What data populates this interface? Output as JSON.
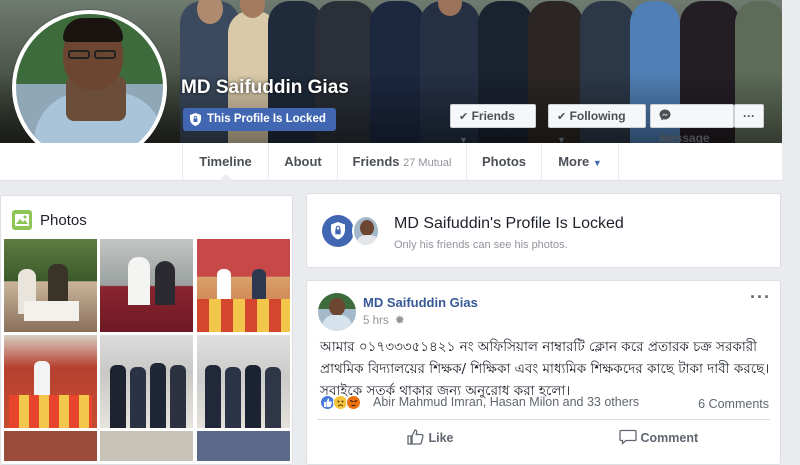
{
  "profile": {
    "name": "MD Saifuddin Gias",
    "locked_badge": "This Profile Is Locked"
  },
  "cover_buttons": {
    "friends": "Friends",
    "following": "Following",
    "message": "Message",
    "more": "···"
  },
  "nav": {
    "timeline": "Timeline",
    "about": "About",
    "friends": "Friends",
    "friends_mutual": "27 Mutual",
    "photos": "Photos",
    "more": "More"
  },
  "photos_panel": {
    "title": "Photos"
  },
  "locked_notice": {
    "title": "MD Saifuddin's Profile Is Locked",
    "subtitle": "Only his friends can see his photos."
  },
  "post": {
    "author": "MD Saifuddin Gias",
    "time": "5 hrs",
    "options": "···",
    "text": "আমার ০১৭৩৩৩৫১৪২১ নং অফিসিয়াল নাম্বারটি ক্লোন করে প্রতারক চক্র সরকারী প্রাথমিক বিদ্যালয়ের শিক্ষক/ শিক্ষিকা এবং মাধ্যমিক শিক্ষকদের কাছে টাকা দাবী করছে। সবাইকে সতর্ক থাকার জন্য অনুরোধ করা হলো।",
    "reactions_text": "Abir Mahmud Imran, Hasan Milon and 33 others",
    "comments_count": "6 Comments",
    "like_label": "Like",
    "comment_label": "Comment"
  },
  "icons": {
    "friends": "check-icon",
    "following": "check-icon",
    "message": "messenger-icon",
    "photos": "photos-icon",
    "lock": "shield-lock-icon",
    "globe": "gear-icon",
    "like": "thumbs-up-icon",
    "comment": "comment-icon"
  },
  "colors": {
    "brand": "#4267b2",
    "link": "#365899",
    "background": "#e9ebee"
  }
}
